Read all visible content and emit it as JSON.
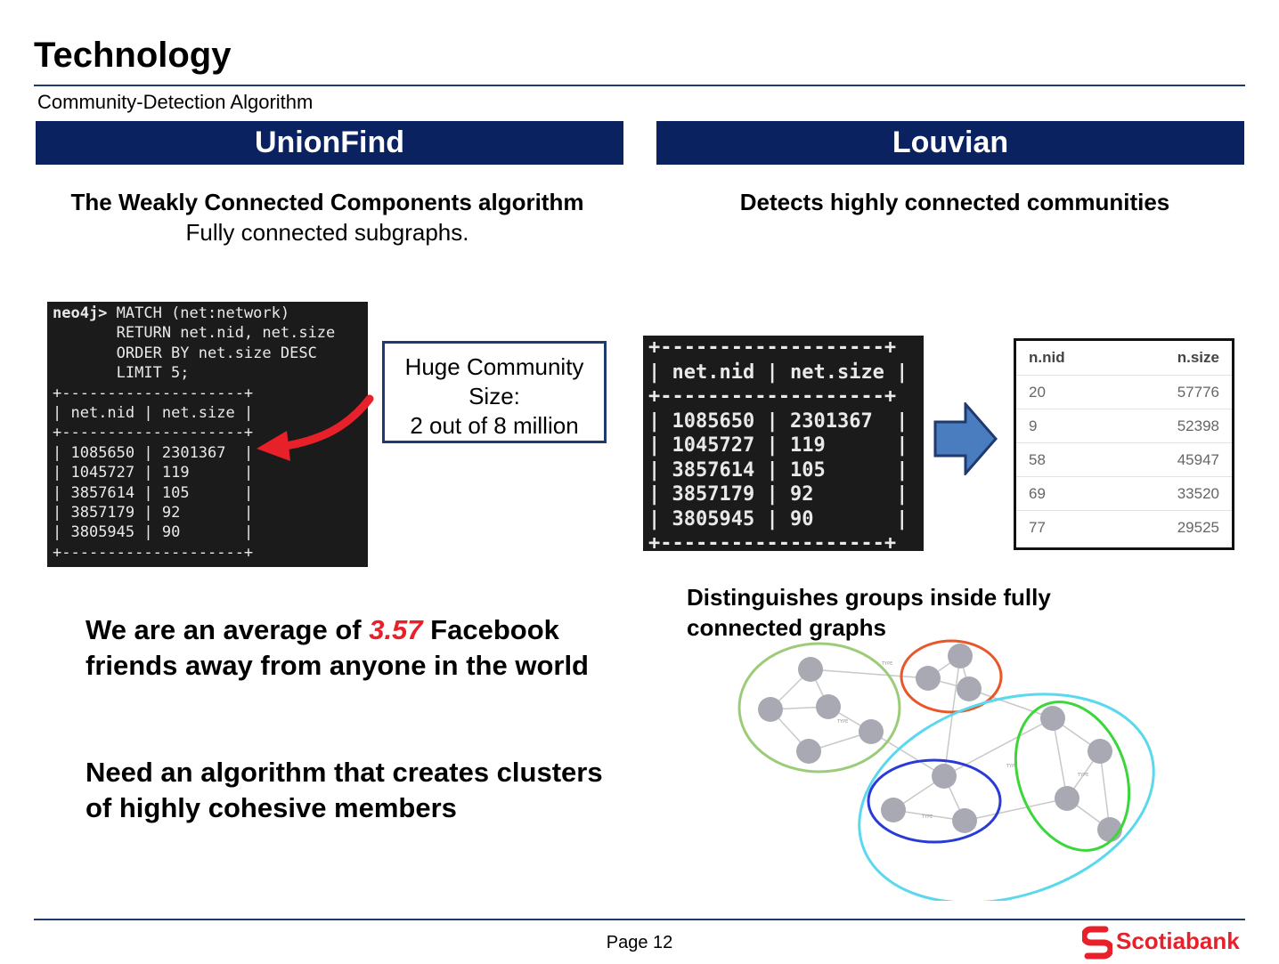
{
  "header": {
    "title": "Technology",
    "subtitle": "Community-Detection Algorithm"
  },
  "left": {
    "banner": "UnionFind",
    "heading": "The Weakly Connected Components algorithm",
    "subheading": "Fully connected subgraphs.",
    "terminal": {
      "prompt": "neo4j>",
      "query_lines": [
        " MATCH (net:network)",
        "       RETURN net.nid, net.size",
        "       ORDER BY net.size DESC",
        "       LIMIT 5;"
      ],
      "columns": [
        "net.nid",
        "net.size"
      ],
      "rows": [
        [
          "1085650",
          "2301367"
        ],
        [
          "1045727",
          "119"
        ],
        [
          "3857614",
          "105"
        ],
        [
          "3857179",
          "92"
        ],
        [
          "3805945",
          "90"
        ]
      ]
    },
    "callout": [
      "Huge Community",
      "Size:",
      "2 out of 8 million"
    ],
    "fact_prefix": "We are an average of ",
    "fact_value": "3.57",
    "fact_suffix_1": " Facebook",
    "fact_line_2": "friends away from anyone in the world",
    "need_line_1": "Need an algorithm that creates clusters",
    "need_line_2": "of highly cohesive members"
  },
  "right": {
    "banner": "Louvian",
    "heading": "Detects highly connected communities",
    "terminal": {
      "columns": [
        "net.nid",
        "net.size"
      ],
      "rows": [
        [
          "1085650",
          "2301367"
        ],
        [
          "1045727",
          "119"
        ],
        [
          "3857614",
          "105"
        ],
        [
          "3857179",
          "92"
        ],
        [
          "3805945",
          "90"
        ]
      ]
    },
    "result_table": {
      "columns": [
        "n.nid",
        "n.size"
      ],
      "rows": [
        [
          "20",
          "57776"
        ],
        [
          "9",
          "52398"
        ],
        [
          "58",
          "45947"
        ],
        [
          "69",
          "33520"
        ],
        [
          "77",
          "29525"
        ]
      ]
    },
    "caption_line_1": "Distinguishes groups inside fully",
    "caption_line_2": "connected graphs",
    "graph_edge_label": "TYPE"
  },
  "footer": {
    "page": "Page 12",
    "brand": "Scotiabank"
  },
  "colors": {
    "banner": "#0b2260",
    "accent_red": "#e8202a",
    "arrow_blue": "#4a7cc0",
    "cluster_green_light": "#9ccc7a",
    "cluster_orange": "#e8572a",
    "cluster_cyan": "#5ad8ee",
    "cluster_green": "#3ad63a",
    "cluster_blue": "#2a3ad6"
  }
}
